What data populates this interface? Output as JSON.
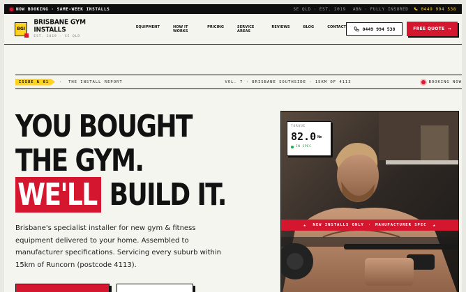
{
  "topbar": {
    "left_primary": "NOW BOOKING",
    "left_separator": "·",
    "left_secondary": "SAME-WEEK INSTALLS",
    "region": "SE QLD",
    "dot": "·",
    "established": "EST. 2019",
    "abn": "ABN",
    "insured": "FULLY INSURED",
    "phone": "0449 994 538"
  },
  "header": {
    "logo_text": "BGI",
    "brand_name": "BRISBANE GYM INSTALLS",
    "brand_sub": "EST. 2019 · SE QLD",
    "nav": [
      "EQUIPMENT",
      "HOW IT WORKS",
      "PRICING",
      "SERVICE AREAS",
      "REVIEWS",
      "BLOG",
      "CONTACT"
    ],
    "phone_button": "0449 994 538",
    "quote_button": "FREE QUOTE",
    "quote_arrow": "→"
  },
  "issue_bar": {
    "tag": "ISSUE № 01",
    "sep": "·",
    "report": "THE INSTALL REPORT",
    "volume": "VOL. 7 · BRISBANE SOUTHSIDE · 15KM OF 4113",
    "booking": "BOOKING NOW"
  },
  "hero": {
    "line1": "YOU BOUGHT",
    "line2": "THE GYM.",
    "line3_highlight": "WE'LL",
    "line3_rest": "BUILD IT.",
    "lead": "Brisbane's specialist installer for new gym & fitness equipment delivered to your home. Assembled to manufacturer specifications. Servicing every suburb within 15km of Runcorn (postcode 4113)."
  },
  "photo_card": {
    "torque_label": "TORQUE",
    "torque_value": "82.0",
    "torque_unit": "Nm",
    "torque_status": "IN SPEC",
    "band_left": "NEW INSTALLS ONLY",
    "band_sep": "·",
    "band_right": "MANUFACTURER SPEC",
    "band_star": "★"
  },
  "colors": {
    "accent_red": "#d5162f",
    "accent_yellow": "#ffd21e",
    "ink": "#111111",
    "paper": "#f5f5f0",
    "status_green": "#1ab040"
  },
  "icons": {
    "status_dot": "red-dot-icon",
    "phone": "phone-icon",
    "arrow": "arrow-right-icon",
    "star": "star-icon"
  }
}
